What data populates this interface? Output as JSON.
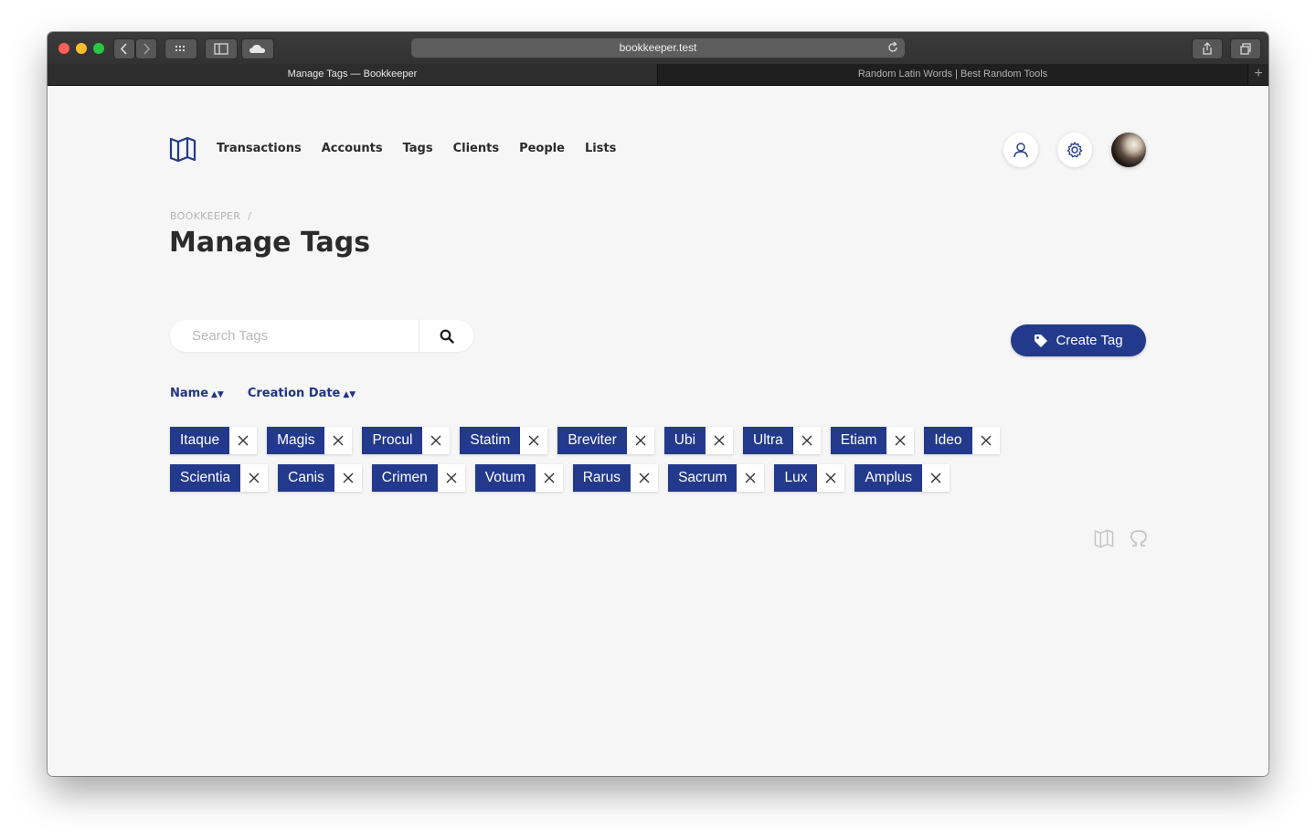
{
  "browser": {
    "url": "bookkeeper.test",
    "tabs": [
      {
        "title": "Manage Tags — Bookkeeper"
      },
      {
        "title": "Random Latin Words | Best Random Tools"
      }
    ]
  },
  "nav": {
    "items": [
      "Transactions",
      "Accounts",
      "Tags",
      "Clients",
      "People",
      "Lists"
    ]
  },
  "breadcrumb": {
    "root": "BOOKKEEPER",
    "separator": "/"
  },
  "page": {
    "title": "Manage Tags"
  },
  "search": {
    "placeholder": "Search Tags",
    "value": ""
  },
  "create_button": {
    "label": "Create Tag"
  },
  "sort": {
    "name": "Name",
    "date": "Creation Date"
  },
  "tags": {
    "row1": [
      "Itaque",
      "Magis",
      "Procul",
      "Statim",
      "Breviter",
      "Ubi",
      "Ultra",
      "Etiam",
      "Ideo"
    ],
    "row2": [
      "Scientia",
      "Canis",
      "Crimen",
      "Votum",
      "Rarus",
      "Sacrum",
      "Lux",
      "Amplus"
    ]
  },
  "colors": {
    "accent": "#233a8c",
    "background": "#f6f6f6"
  },
  "icons": {
    "logo": "map-icon",
    "user": "user-icon",
    "settings": "gear-icon",
    "search": "search-icon",
    "tag": "tag-icon",
    "remove": "close-icon",
    "footer": [
      "map-icon",
      "omega-icon"
    ]
  }
}
